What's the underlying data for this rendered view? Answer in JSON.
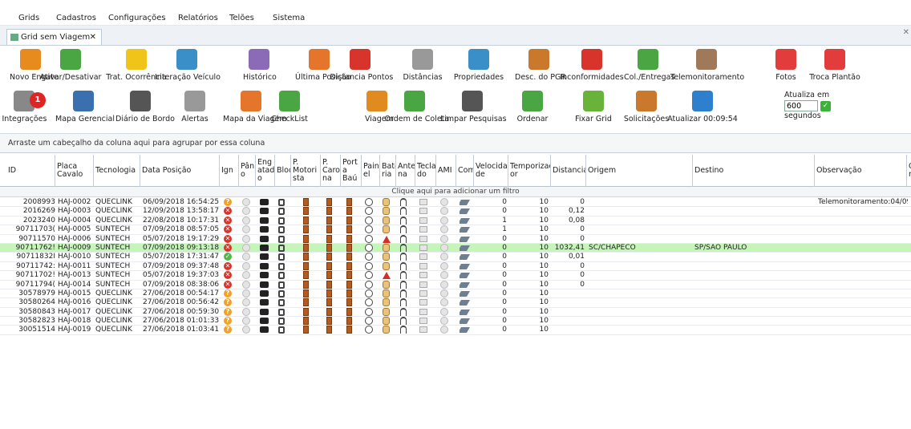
{
  "menu": [
    "Grids",
    "Cadastros",
    "Configurações",
    "Relatórios",
    "Telões",
    "Sistema"
  ],
  "tab": {
    "label": "Grid sem Viagem",
    "close": "✕"
  },
  "toolbar_row1": [
    {
      "label": "Novo Engate",
      "icon": "trailer-hitch-icon"
    },
    {
      "label": "Ativar/Desativar",
      "icon": "truck-check-icon"
    },
    {
      "label": "Trat. Ocorrência",
      "icon": "warning-icon"
    },
    {
      "label": "Interação Veículo",
      "icon": "globe-gear-icon"
    },
    {
      "label": "Histórico",
      "icon": "history-icon"
    },
    {
      "label": "Última Posição",
      "icon": "last-position-icon"
    },
    {
      "label": "Distancia Pontos",
      "icon": "route-arrow-icon"
    },
    {
      "label": "Distâncias",
      "icon": "ruler-icon"
    },
    {
      "label": "Propriedades",
      "icon": "properties-icon"
    },
    {
      "label": "Desc. do PGR",
      "icon": "book-icon"
    },
    {
      "label": "Inconformidades",
      "icon": "error-x-icon"
    },
    {
      "label": "Col./Entregas",
      "icon": "delivery-truck-icon"
    },
    {
      "label": "Telemonitoramento",
      "icon": "operator-icon"
    },
    {
      "label": "Fotos",
      "icon": "camera-icon"
    },
    {
      "label": "Troca Plantão",
      "icon": "shift-change-icon"
    }
  ],
  "toolbar_row2": [
    {
      "label": "Integrações",
      "icon": "gears-icon",
      "badge": "1"
    },
    {
      "label": "Mapa Gerencial",
      "icon": "map-icon"
    },
    {
      "label": "Diário de Bordo",
      "icon": "logbook-icon"
    },
    {
      "label": "Alertas",
      "icon": "alerts-icon"
    },
    {
      "label": "Mapa da Viagem",
      "icon": "trip-map-icon"
    },
    {
      "label": "CheckList",
      "icon": "checklist-icon"
    },
    {
      "label": "Viagem",
      "icon": "location-pin-icon"
    },
    {
      "label": "Ordem de Coleta",
      "icon": "collection-order-icon"
    },
    {
      "label": "Limpar Pesquisas",
      "icon": "clear-search-icon"
    },
    {
      "label": "Ordenar",
      "icon": "sort-icon"
    },
    {
      "label": "Fixar Grid",
      "icon": "pin-icon"
    },
    {
      "label": "Solicitações",
      "icon": "requests-icon"
    },
    {
      "label": "Atualizar 00:09:54",
      "icon": "refresh-icon"
    }
  ],
  "refresh": {
    "label_top": "Atualiza em",
    "value": "600",
    "label_bottom": "segundos"
  },
  "group_panel": "Arraste um cabeçalho da coluna aqui para agrupar por essa coluna",
  "filter_row": "Clique aqui para adicionar um filtro",
  "columns": [
    "ID",
    "Placa Cavalo",
    "Tecnologia",
    "Data Posição",
    "Ign",
    "Pânic o",
    "Eng atad o",
    "Bloq",
    "P. Motori sta",
    "P. Caro na",
    "Port a Baú",
    "Pain el",
    "Bate ria",
    "Ante na",
    "Tecla do",
    "AMI",
    "Com",
    "Velocida de",
    "Temporizad or",
    "Distancia",
    "Origem",
    "Destino",
    "Observação",
    "O n"
  ],
  "rows": [
    {
      "id": "2008993",
      "placa": "HAJ-0002",
      "tec": "QUECLINK",
      "data": "06/09/2018 16:54:25",
      "ign": "q",
      "lock": "unlocked",
      "bat": "batt",
      "vel": "0",
      "temp": "10",
      "dist": "0",
      "orig": "",
      "dest": "",
      "obs": "Telemonitoramento:04/09/"
    },
    {
      "id": "2016269",
      "placa": "HAJ-0003",
      "tec": "QUECLINK",
      "data": "12/09/2018 13:58:17",
      "ign": "x",
      "lock": "unlocked",
      "bat": "batt",
      "vel": "0",
      "temp": "10",
      "dist": "0,12",
      "orig": "",
      "dest": "",
      "obs": ""
    },
    {
      "id": "2023240",
      "placa": "HAJ-0004",
      "tec": "QUECLINK",
      "data": "22/08/2018 10:17:31",
      "ign": "x",
      "lock": "unlocked",
      "bat": "batt",
      "vel": "1",
      "temp": "10",
      "dist": "0,08",
      "orig": "",
      "dest": "",
      "obs": ""
    },
    {
      "id": "90711703(",
      "placa": "HAJ-0005",
      "tec": "SUNTECH",
      "data": "07/09/2018 08:57:05",
      "ign": "x",
      "lock": "unlocked",
      "bat": "batt",
      "vel": "1",
      "temp": "10",
      "dist": "0",
      "orig": "",
      "dest": "",
      "obs": ""
    },
    {
      "id": "90711570",
      "placa": "HAJ-0006",
      "tec": "SUNTECH",
      "data": "05/07/2018 19:17:29",
      "ign": "x",
      "lock": "unlocked",
      "bat": "warn",
      "vel": "0",
      "temp": "10",
      "dist": "0",
      "orig": "",
      "dest": "",
      "obs": ""
    },
    {
      "id": "90711762!",
      "placa": "HAJ-0009",
      "tec": "SUNTECH",
      "data": "07/09/2018 09:13:18",
      "ign": "x",
      "lock": "unlocked",
      "bat": "batt",
      "vel": "0",
      "temp": "10",
      "dist": "1032,41",
      "orig": "SC/CHAPECO",
      "dest": "SP/SAO PAULO",
      "obs": "",
      "sel": true
    },
    {
      "id": "90711832I",
      "placa": "HAJ-0010",
      "tec": "SUNTECH",
      "data": "05/07/2018 17:31:47",
      "ign": "ok",
      "lock": "locked",
      "bat": "batt",
      "vel": "0",
      "temp": "10",
      "dist": "0,01",
      "orig": "",
      "dest": "",
      "obs": ""
    },
    {
      "id": "90711742:",
      "placa": "HAJ-0011",
      "tec": "SUNTECH",
      "data": "07/09/2018 09:37:48",
      "ign": "x",
      "lock": "unlocked",
      "bat": "batt",
      "vel": "0",
      "temp": "10",
      "dist": "0",
      "orig": "",
      "dest": "",
      "obs": ""
    },
    {
      "id": "90711702!",
      "placa": "HAJ-0013",
      "tec": "SUNTECH",
      "data": "05/07/2018 19:37:03",
      "ign": "x",
      "lock": "unlocked",
      "bat": "warn",
      "vel": "0",
      "temp": "10",
      "dist": "0",
      "orig": "",
      "dest": "",
      "obs": ""
    },
    {
      "id": "90711794(",
      "placa": "HAJ-0014",
      "tec": "SUNTECH",
      "data": "07/09/2018 08:38:06",
      "ign": "x",
      "lock": "unlocked",
      "bat": "batt",
      "vel": "0",
      "temp": "10",
      "dist": "0",
      "orig": "",
      "dest": "",
      "obs": ""
    },
    {
      "id": "30578979",
      "placa": "HAJ-0015",
      "tec": "QUECLINK",
      "data": "27/06/2018 00:54:17",
      "ign": "q",
      "lock": "unlocked",
      "bat": "batt",
      "vel": "0",
      "temp": "10",
      "dist": "",
      "orig": "",
      "dest": "",
      "obs": ""
    },
    {
      "id": "30580264",
      "placa": "HAJ-0016",
      "tec": "QUECLINK",
      "data": "27/06/2018 00:56:42",
      "ign": "q",
      "lock": "unlocked",
      "bat": "batt",
      "vel": "0",
      "temp": "10",
      "dist": "",
      "orig": "",
      "dest": "",
      "obs": ""
    },
    {
      "id": "30580843",
      "placa": "HAJ-0017",
      "tec": "QUECLINK",
      "data": "27/06/2018 00:59:30",
      "ign": "q",
      "lock": "unlocked",
      "bat": "batt",
      "vel": "0",
      "temp": "10",
      "dist": "",
      "orig": "",
      "dest": "",
      "obs": ""
    },
    {
      "id": "30582823",
      "placa": "HAJ-0018",
      "tec": "QUECLINK",
      "data": "27/06/2018 01:01:33",
      "ign": "q",
      "lock": "unlocked",
      "bat": "batt",
      "vel": "0",
      "temp": "10",
      "dist": "",
      "orig": "",
      "dest": "",
      "obs": ""
    },
    {
      "id": "30051514",
      "placa": "HAJ-0019",
      "tec": "QUECLINK",
      "data": "27/06/2018 01:03:41",
      "ign": "q",
      "lock": "unlocked",
      "bat": "batt",
      "vel": "0",
      "temp": "10",
      "dist": "",
      "orig": "",
      "dest": "",
      "obs": ""
    }
  ],
  "colors": {
    "selected_row": "#c5f5b9",
    "error": "#d9342b",
    "warning": "#f2a028",
    "ok": "#52b847"
  }
}
